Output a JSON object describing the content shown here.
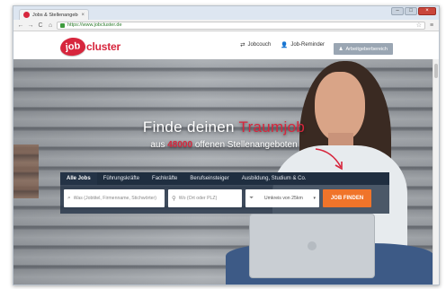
{
  "browser": {
    "tab_title": "Jobs & Stellenangebo",
    "tab_close": "×",
    "url": "https://www.jobcluster.de",
    "nav": {
      "back": "←",
      "forward": "→",
      "reload": "C",
      "home": "⌂"
    },
    "star": "☆",
    "menu": "≡",
    "window_controls": {
      "minimize": "–",
      "maximize": "□",
      "close": "×"
    }
  },
  "header": {
    "logo_badge": "job",
    "logo_text": "cluster",
    "links": [
      {
        "icon": "⇄",
        "label": "Jobcouch"
      },
      {
        "icon": "👤",
        "label": "Job-Reminder"
      }
    ],
    "employer_button": {
      "icon": "♟",
      "label": "Arbeitgeberbereich"
    }
  },
  "hero": {
    "headline_main": "Finde deinen",
    "headline_accent": "Traumjob",
    "sub_prefix": "aus",
    "sub_count": "48000",
    "sub_suffix": "offenen Stellenangeboten"
  },
  "search": {
    "tabs": [
      {
        "label": "Alle Jobs",
        "active": true
      },
      {
        "label": "Führungskräfte",
        "active": false
      },
      {
        "label": "Fachkräfte",
        "active": false
      },
      {
        "label": "Berufseinsteiger",
        "active": false
      },
      {
        "label": "Ausbildung, Studium & Co.",
        "active": false
      }
    ],
    "what_placeholder": "Was (Jobtitel, Firmenname, Stichwörter)",
    "where_placeholder": "Wo (Ort oder PLZ)",
    "radius_label": "Umkreis von 25km",
    "radius_caret": "▾",
    "find_button": "JOB FINDEN"
  },
  "colors": {
    "brand_red": "#d7263d",
    "find_button": "#f0742a",
    "panel": "#28374b"
  }
}
